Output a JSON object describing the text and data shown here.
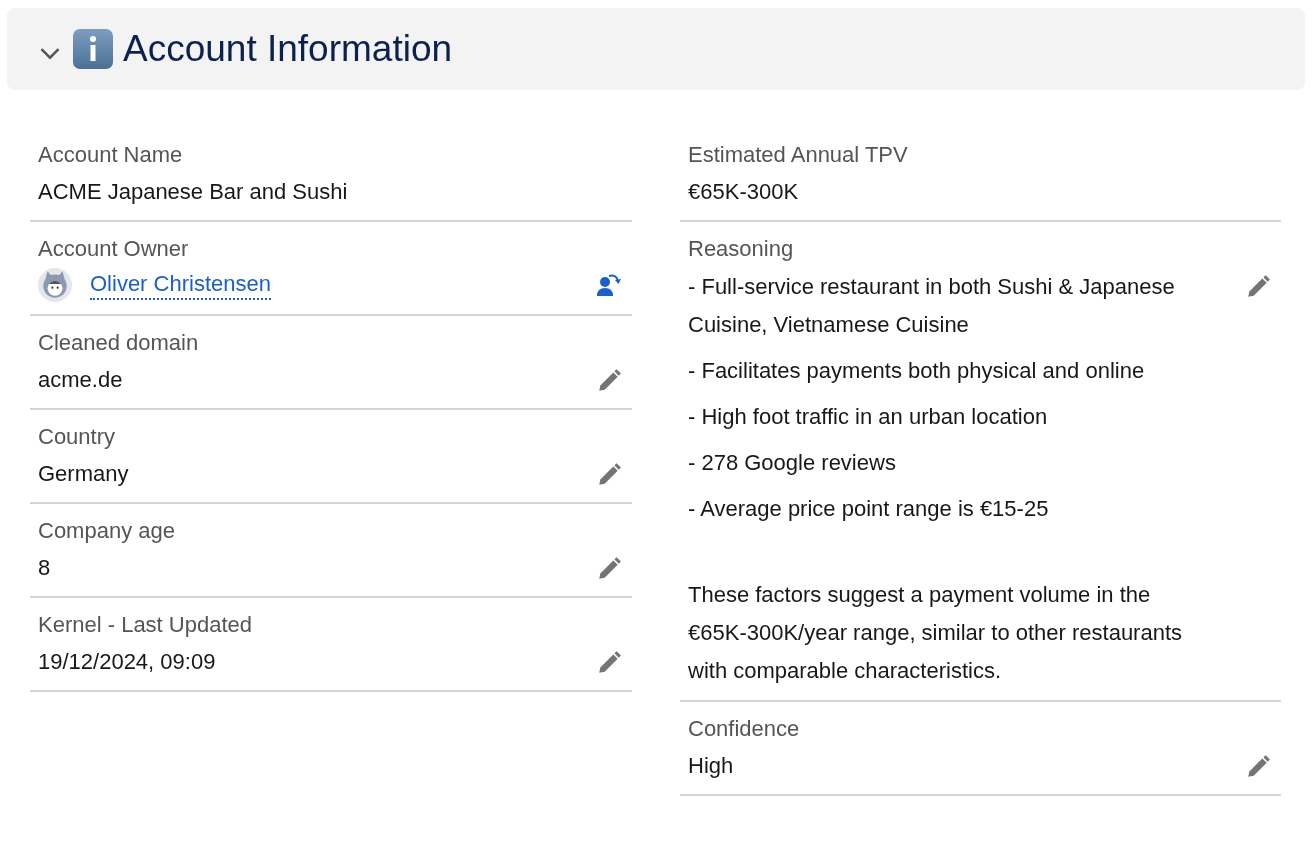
{
  "section": {
    "title": "Account Information",
    "expanded": true
  },
  "columns": [
    {
      "fields": [
        {
          "kind": "text",
          "label": "Account Name",
          "value": "ACME Japanese Bar and Sushi",
          "editable": false
        },
        {
          "kind": "user",
          "label": "Account Owner",
          "value": "Oliver Christensen",
          "editable": false
        },
        {
          "kind": "text",
          "label": "Cleaned domain",
          "value": "acme.de",
          "editable": true
        },
        {
          "kind": "text",
          "label": "Country",
          "value": "Germany",
          "editable": true
        },
        {
          "kind": "text",
          "label": "Company age",
          "value": "8",
          "editable": true
        },
        {
          "kind": "text",
          "label": "Kernel - Last Updated",
          "value": "19/12/2024, 09:09",
          "editable": true
        }
      ]
    },
    {
      "fields": [
        {
          "kind": "text",
          "label": "Estimated Annual TPV",
          "value": "€65K-300K",
          "editable": false
        },
        {
          "kind": "lines",
          "label": "Reasoning",
          "editable": true,
          "lines": [
            "- Full-service restaurant in both Sushi & Japanese Cuisine, Vietnamese Cuisine",
            "- Facilitates payments both physical and online",
            "- High foot traffic in an urban location",
            "- 278 Google reviews",
            "- Average price point range is €15-25",
            "These factors suggest a payment volume in the €65K-300K/year range, similar to other restaurants with comparable characteristics."
          ]
        },
        {
          "kind": "text",
          "label": "Confidence",
          "value": "High",
          "editable": true
        }
      ]
    }
  ]
}
